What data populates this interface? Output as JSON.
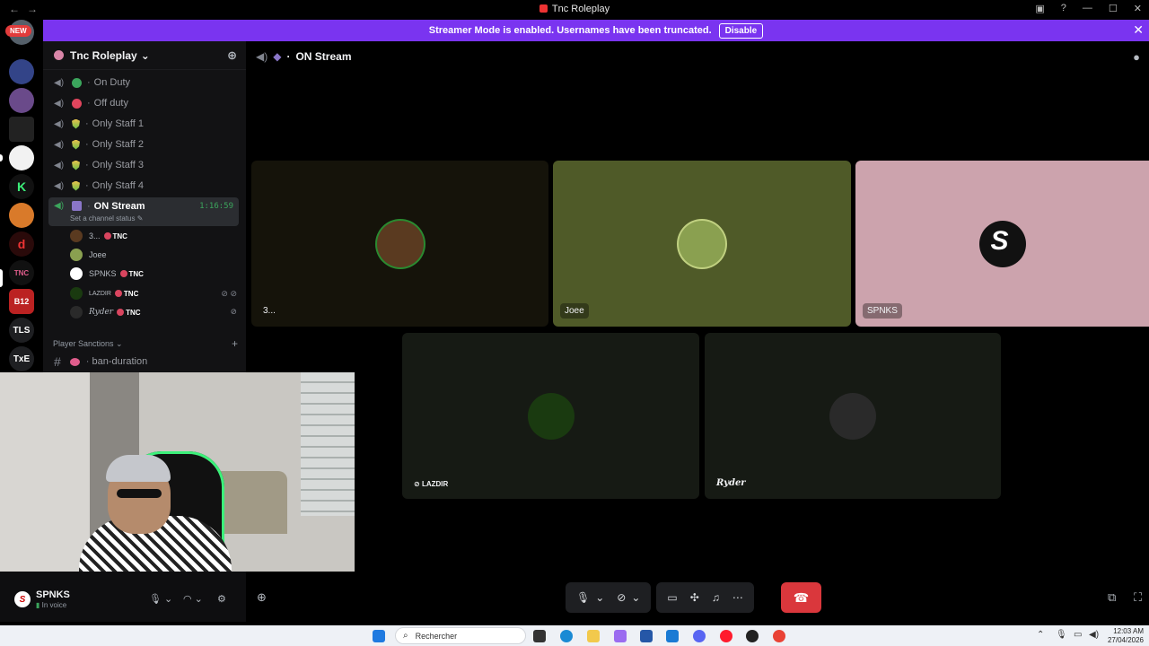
{
  "window": {
    "title": "Tnc Roleplay",
    "back": "←",
    "forward": "→"
  },
  "banner": {
    "text": "Streamer Mode is enabled. Usernames have been truncated.",
    "button": "Disable",
    "close": "✕"
  },
  "rail": {
    "new_badge": "NEW",
    "servers": [
      "TLS",
      "TxE"
    ]
  },
  "sidebar": {
    "guild_name": "Tnc Roleplay",
    "guild_chevron": "⌄",
    "channels": [
      {
        "name": "On Duty",
        "emoji_color": "#3ba55c"
      },
      {
        "name": "Off duty",
        "emoji_color": "#e0455d"
      },
      {
        "name": "Only Staff 1"
      },
      {
        "name": "Only Staff 2"
      },
      {
        "name": "Only Staff 3"
      },
      {
        "name": "Only Staff 4"
      }
    ],
    "active_channel": {
      "name": "ON Stream",
      "timer": "1:16:59",
      "status": "Set a channel status ✎"
    },
    "members": [
      {
        "name": "3...",
        "tag": "TNC"
      },
      {
        "name": "Joee",
        "tag": ""
      },
      {
        "name": "SPNKS",
        "tag": "TNC"
      },
      {
        "name": "LAZDIR",
        "tag": "TNC"
      },
      {
        "name": "Ryder",
        "tag": "TNC"
      }
    ],
    "category": "Player Sanctions ⌄",
    "category_add": "+",
    "text_channel": "ban-duration"
  },
  "user_panel": {
    "name": "SPNKS",
    "status": "In voice"
  },
  "stage": {
    "channel": "ON Stream",
    "tiles": [
      {
        "name": "3...",
        "bg": "#15130a",
        "avatar": "#5a3a20"
      },
      {
        "name": "Joee",
        "bg": "#4f5a28",
        "avatar": "#8aa050"
      },
      {
        "name": "SPNKS",
        "bg": "#cca3ad",
        "avatar": "#111111"
      },
      {
        "name": "LAZDIR",
        "bg": "#161a14",
        "avatar": "#1a3a10"
      },
      {
        "name": "Ryder",
        "bg": "#161a14",
        "avatar": "#2a2a2a"
      }
    ]
  },
  "taskbar": {
    "search": "Rechercher",
    "time": "12:03 AM",
    "date": "27/04/2026"
  },
  "colors": {
    "banner": "#7a34f0",
    "end_call": "#da373c",
    "accent_green": "#3ba55c"
  }
}
